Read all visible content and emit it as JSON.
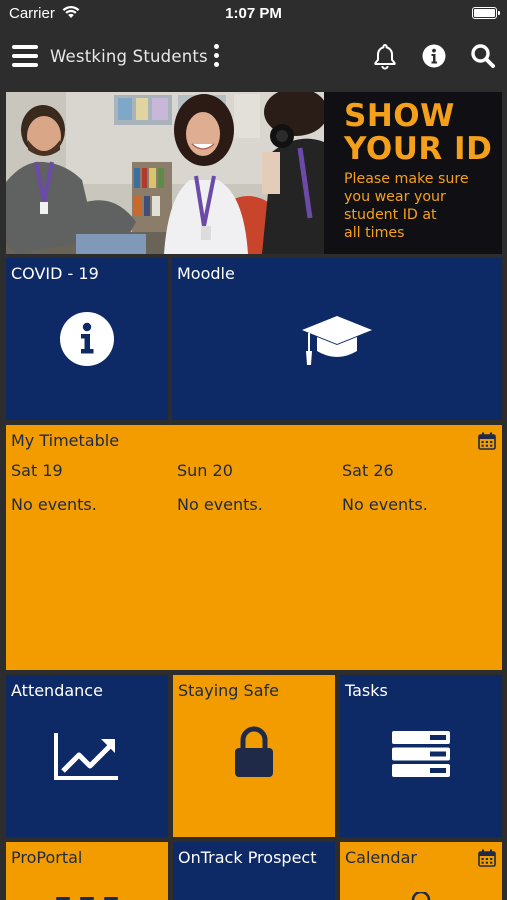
{
  "status_bar": {
    "carrier": "Carrier",
    "time": "1:07 PM"
  },
  "nav": {
    "title": "Westking Students"
  },
  "banner": {
    "heading": "SHOW\nYOUR ID",
    "subtext": "Please make sure\nyou wear your\nstudent ID at\nall times"
  },
  "tiles": {
    "covid": {
      "label": "COVID - 19",
      "icon": "info-circle-icon"
    },
    "moodle": {
      "label": "Moodle",
      "icon": "graduation-cap-icon"
    },
    "timetable": {
      "label": "My Timetable",
      "icon": "calendar-icon",
      "days": [
        {
          "date": "Sat 19",
          "events": "No events."
        },
        {
          "date": "Sun 20",
          "events": "No events."
        },
        {
          "date": "Sat 26",
          "events": "No events."
        }
      ]
    },
    "attendance": {
      "label": "Attendance",
      "icon": "trending-chart-icon"
    },
    "staying_safe": {
      "label": "Staying Safe",
      "icon": "padlock-icon"
    },
    "tasks": {
      "label": "Tasks",
      "icon": "task-list-icon"
    },
    "proportal": {
      "label": "ProPortal"
    },
    "ontrack": {
      "label": "OnTrack Prospect"
    },
    "calendar": {
      "label": "Calendar",
      "icon": "calendar-icon"
    }
  },
  "colors": {
    "navy": "#0e2a66",
    "orange": "#f29c00",
    "bar": "#2d2d2d",
    "banner_text": "#f5a01a"
  }
}
